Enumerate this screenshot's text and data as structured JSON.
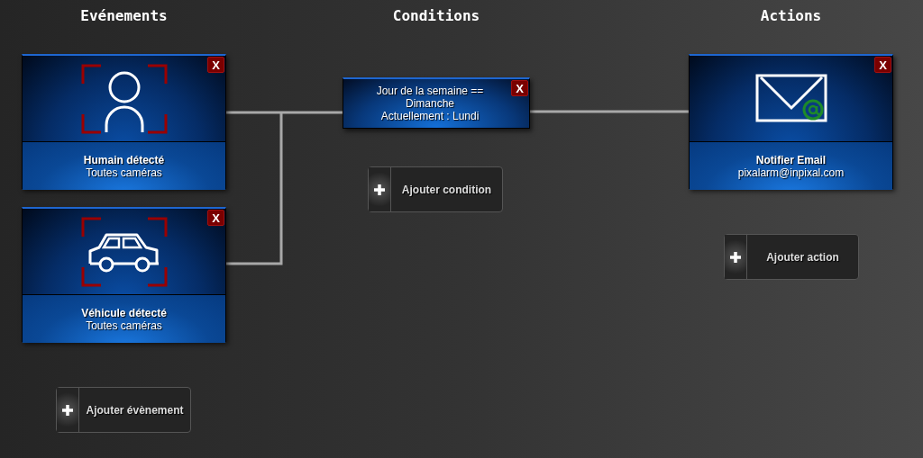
{
  "columns": [
    {
      "kind": "events",
      "title": "Evénements",
      "cards": [
        {
          "kind": "person",
          "title": "Humain détecté",
          "subtitle": "Toutes caméras",
          "close_label": "X"
        },
        {
          "kind": "car",
          "title": "Véhicule détecté",
          "subtitle": "Toutes caméras",
          "close_label": "X"
        }
      ],
      "add_button": {
        "label": "Ajouter évènement"
      }
    },
    {
      "kind": "conditions",
      "title": "Conditions",
      "cards": [
        {
          "kind": "condition",
          "lines": [
            "Jour de la semaine ==",
            "Dimanche",
            "Actuellement : Lundi"
          ],
          "close_label": "X"
        }
      ],
      "add_button": {
        "label": "Ajouter condition"
      }
    },
    {
      "kind": "actions",
      "title": "Actions",
      "cards": [
        {
          "kind": "email",
          "title": "Notifier Email",
          "subtitle": "pixalarm@inpixal.com",
          "close_label": "X"
        }
      ],
      "add_button": {
        "label": "Ajouter action"
      }
    }
  ]
}
